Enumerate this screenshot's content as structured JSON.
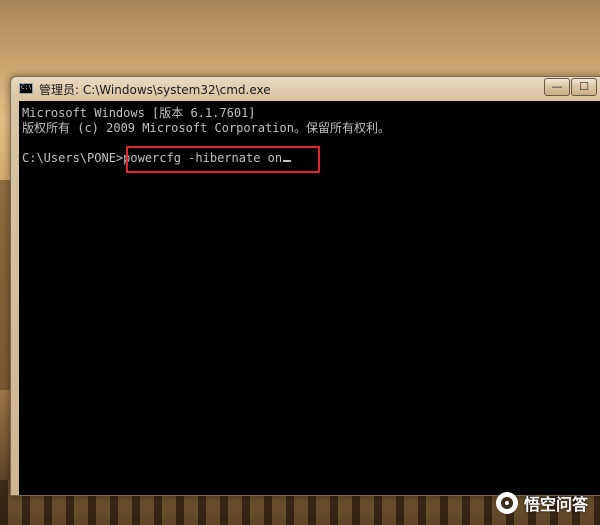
{
  "window": {
    "title": "管理员: C:\\Windows\\system32\\cmd.exe",
    "icon_name": "cmd-icon",
    "icon_text": "C:\\",
    "minimize_glyph": "—",
    "maximize_glyph": "☐"
  },
  "console": {
    "line1": "Microsoft Windows [版本 6.1.7601]",
    "line2": "版权所有 (c) 2009 Microsoft Corporation。保留所有权利。",
    "prompt": "C:\\Users\\PONE>",
    "command": "powercfg -hibernate on",
    "text_color": "#c0c0c0",
    "background_color": "#000000",
    "highlight_color": "#e0262c"
  },
  "watermark": {
    "icon_name": "wukong-logo-icon",
    "text": "悟空问答"
  }
}
